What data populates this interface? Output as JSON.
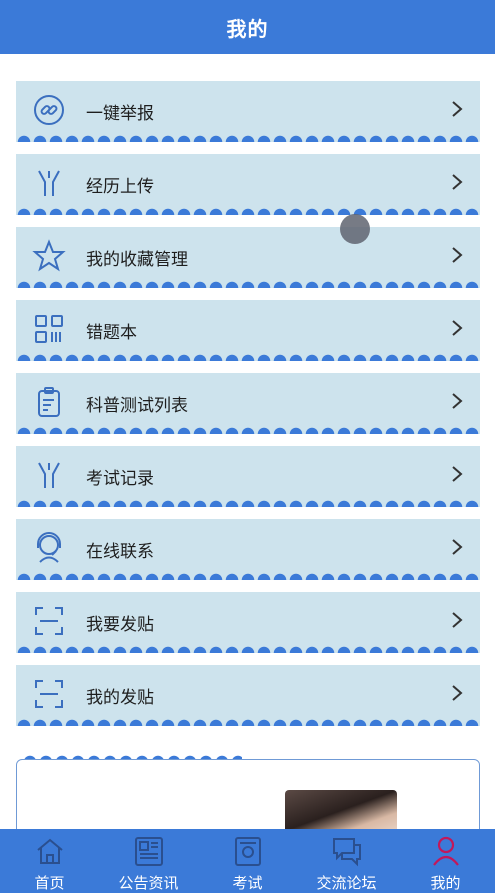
{
  "header": {
    "title": "我的"
  },
  "menu": [
    {
      "label": "一键举报",
      "icon": "link-icon"
    },
    {
      "label": "经历上传",
      "icon": "fork-icon"
    },
    {
      "label": "我的收藏管理",
      "icon": "star-icon"
    },
    {
      "label": "错题本",
      "icon": "qr-grid-icon"
    },
    {
      "label": "科普测试列表",
      "icon": "clipboard-icon"
    },
    {
      "label": "考试记录",
      "icon": "fork-icon"
    },
    {
      "label": "在线联系",
      "icon": "headset-icon"
    },
    {
      "label": "我要发贴",
      "icon": "scan-frame-icon"
    },
    {
      "label": "我的发贴",
      "icon": "scan-frame-icon"
    }
  ],
  "tabs": [
    {
      "label": "首页",
      "icon": "home-icon"
    },
    {
      "label": "公告资讯",
      "icon": "newspaper-icon"
    },
    {
      "label": "考试",
      "icon": "exam-icon"
    },
    {
      "label": "交流论坛",
      "icon": "chat-icon"
    },
    {
      "label": "我的",
      "icon": "user-icon",
      "active": true
    }
  ],
  "colors": {
    "primary": "#3b7ad8",
    "item_bg": "#cde3ed",
    "icon_stroke": "#3b6fbf",
    "active_tab_icon": "#c2185b"
  }
}
